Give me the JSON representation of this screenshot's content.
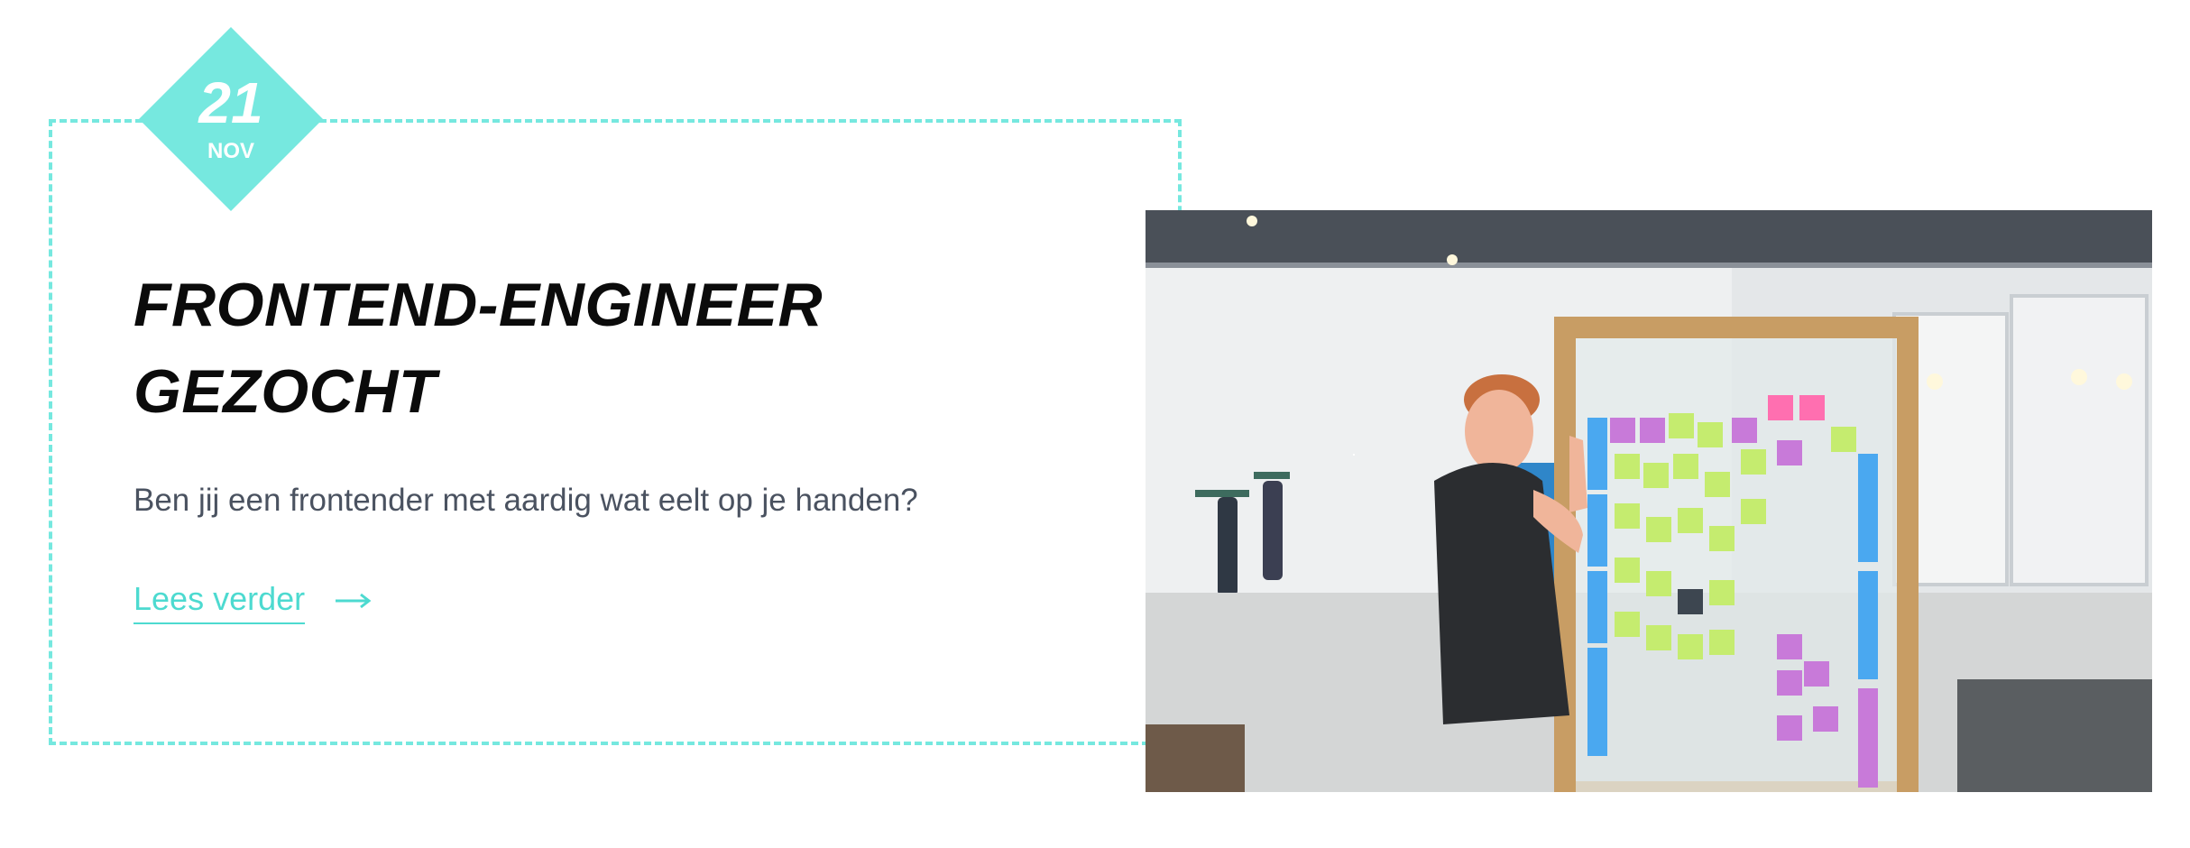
{
  "post": {
    "date": {
      "day": "21",
      "month": "NOV"
    },
    "title_line1": "FRONTEND-ENGINEER",
    "title_line2": "GEZOCHT",
    "excerpt": "Ben jij een frontender met aardig wat eelt op je handen?",
    "read_more_label": "Lees verder",
    "read_more_icon": "arrow-right-icon",
    "image_alt": "Man schrijft op sticky notes op een glazen scrumbord in een kantoor"
  },
  "colors": {
    "accent": "#76e8df",
    "link": "#4ddad0",
    "title": "#0b0b0b",
    "text": "#4a5260"
  }
}
